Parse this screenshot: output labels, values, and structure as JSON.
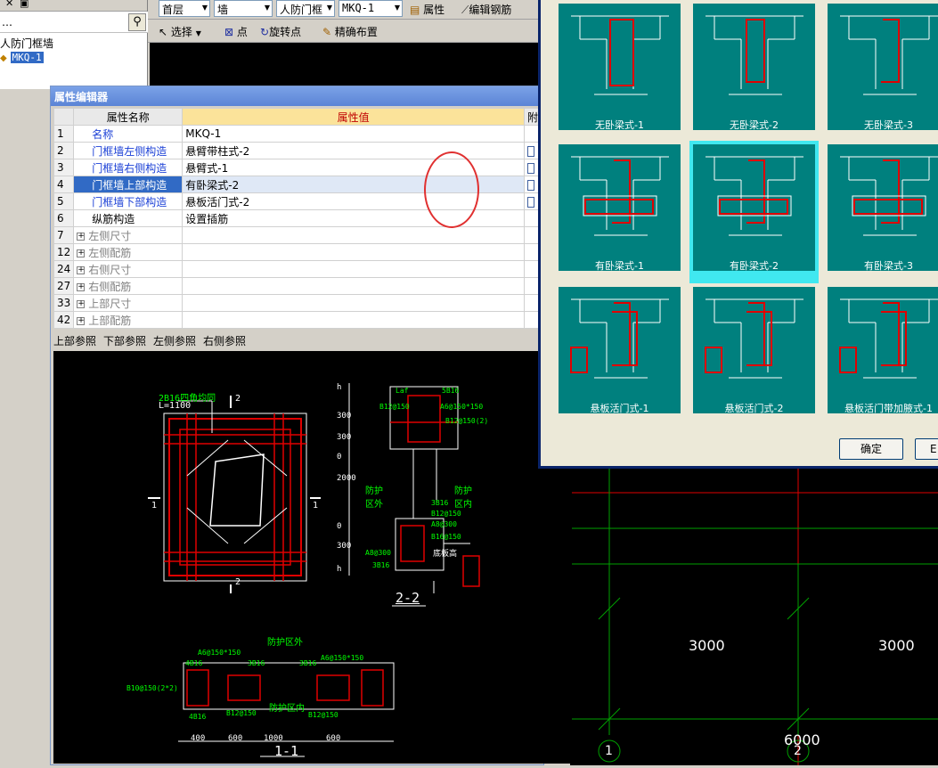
{
  "tree": {
    "search_partial": "…",
    "node_parent": "人防门框墙",
    "node_child": "MKQ-1"
  },
  "toolbar": {
    "floor": "首层",
    "category": "墙",
    "type": "人防门框",
    "name": "MKQ-1",
    "property_btn": "属性",
    "edit_rebar_btn": "编辑钢筋",
    "select_btn": "选择",
    "point_btn": "点",
    "rotate_point_btn": "旋转点",
    "precise_btn": "精确布置"
  },
  "prop_editor": {
    "title": "属性编辑器",
    "col_name": "属性名称",
    "col_value": "属性值",
    "col_extra": "附",
    "rows": [
      {
        "no": "1",
        "name": "名称",
        "value": "MKQ-1",
        "style": "blue",
        "expand": false,
        "check": false
      },
      {
        "no": "2",
        "name": "门框墙左侧构造",
        "value": "悬臂带柱式-2",
        "style": "blue",
        "expand": false,
        "check": true
      },
      {
        "no": "3",
        "name": "门框墙右侧构造",
        "value": "悬臂式-1",
        "style": "blue",
        "expand": false,
        "check": true
      },
      {
        "no": "4",
        "name": "门框墙上部构造",
        "value": "有卧梁式-2",
        "style": "sel",
        "expand": false,
        "check": true
      },
      {
        "no": "5",
        "name": "门框墙下部构造",
        "value": "悬板活门式-2",
        "style": "blue",
        "expand": false,
        "check": true
      },
      {
        "no": "6",
        "name": "纵筋构造",
        "value": "设置插筋",
        "style": "black",
        "expand": false,
        "check": false
      },
      {
        "no": "7",
        "name": "左侧尺寸",
        "value": "",
        "style": "gray",
        "expand": true,
        "check": false
      },
      {
        "no": "12",
        "name": "左侧配筋",
        "value": "",
        "style": "gray",
        "expand": true,
        "check": false
      },
      {
        "no": "24",
        "name": "右侧尺寸",
        "value": "",
        "style": "gray",
        "expand": true,
        "check": false
      },
      {
        "no": "27",
        "name": "右侧配筋",
        "value": "",
        "style": "gray",
        "expand": true,
        "check": false
      },
      {
        "no": "33",
        "name": "上部尺寸",
        "value": "",
        "style": "gray",
        "expand": true,
        "check": false
      },
      {
        "no": "42",
        "name": "上部配筋",
        "value": "",
        "style": "gray",
        "expand": true,
        "check": false
      }
    ],
    "ref_tabs": [
      "上部参照",
      "下部参照",
      "左侧参照",
      "右侧参照"
    ]
  },
  "drawing": {
    "elev_note1": "2B16四角均同",
    "elev_note2": "L=1100",
    "section_mark": "2",
    "side_mark": "1",
    "sec22_title": "2-2",
    "sec11_title": "1-1",
    "dims": [
      "h",
      "300",
      "300",
      "0",
      "2000",
      "0",
      "300",
      "h"
    ],
    "labels": {
      "laf": "Laf",
      "rebar_5b16": "5B16",
      "b12_150": "B12@150",
      "a6_150": "A6@150*150",
      "b12_150_2": "B12@150(2)",
      "prot_out": "防护区外",
      "prot_in": "防护区内",
      "b3_16": "3B16",
      "b12_150b": "B12@150",
      "a8_300": "A8@300",
      "b16_150": "B16@150",
      "a8_300b": "A8@300",
      "b3_16b": "3B16",
      "floor_note": "底板高",
      "b4_16": "4B16",
      "b10_150": "B10@150(2*2)",
      "b3_16c": "3B16",
      "a6_150b": "A6@150*150",
      "b3_16d": "3B16",
      "b12_150c": "B12@150",
      "b12_150d": "B12@150",
      "b4_16b": "4B16",
      "dim400": "400",
      "dim600": "600",
      "dim1000": "1000",
      "dim600b": "600"
    }
  },
  "cad_right": {
    "dim1": "3000",
    "dim2": "3000",
    "dim_total": "6000",
    "axis1": "1",
    "axis2": "2"
  },
  "selector": {
    "options": [
      "无卧梁式-1",
      "无卧梁式-2",
      "无卧梁式-3",
      "有卧梁式-1",
      "有卧梁式-2",
      "有卧梁式-3",
      "悬板活门式-1",
      "悬板活门式-2",
      "悬板活门带加腋式-1"
    ],
    "selected": "有卧梁式-2",
    "ok": "确定",
    "cancel_partial": "E"
  },
  "colors": {
    "teal": "#00807e",
    "selected_cell": "#40e8f0",
    "rebar_red": "#e00000",
    "cad_green": "#00ff00",
    "title_blue": "#5b84d6"
  }
}
